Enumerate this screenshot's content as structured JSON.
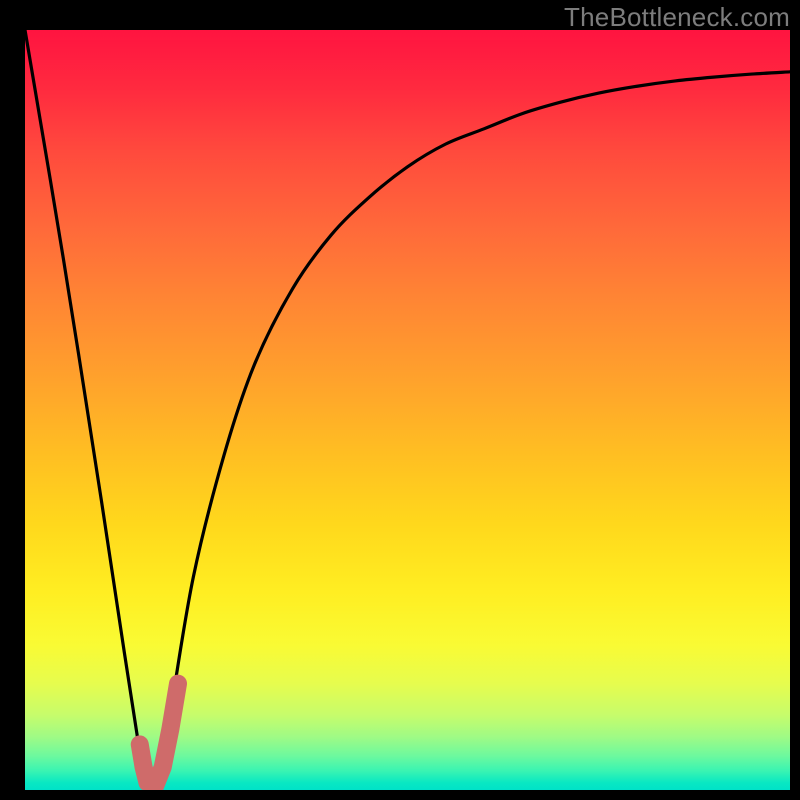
{
  "watermark": "TheBottleneck.com",
  "chart_data": {
    "type": "line",
    "title": "",
    "xlabel": "",
    "ylabel": "",
    "xlim": [
      0,
      100
    ],
    "ylim": [
      0,
      100
    ],
    "grid": false,
    "legend": false,
    "series": [
      {
        "name": "bottleneck-curve",
        "x": [
          0,
          5,
          10,
          13,
          15,
          16,
          17,
          18,
          19,
          22,
          26,
          30,
          35,
          40,
          45,
          50,
          55,
          60,
          65,
          70,
          75,
          80,
          85,
          90,
          95,
          100
        ],
        "values": [
          100,
          70,
          38,
          18,
          5,
          0,
          0,
          3,
          10,
          28,
          44,
          56,
          66,
          73,
          78,
          82,
          85,
          87,
          89,
          90.5,
          91.7,
          92.6,
          93.3,
          93.8,
          94.2,
          94.5
        ]
      }
    ],
    "marker": {
      "name": "highlight-segment",
      "points": [
        {
          "x": 15.0,
          "y": 6.0
        },
        {
          "x": 15.5,
          "y": 3.0
        },
        {
          "x": 16.0,
          "y": 1.0
        },
        {
          "x": 17.0,
          "y": 0.5
        },
        {
          "x": 18.0,
          "y": 3.0
        },
        {
          "x": 19.0,
          "y": 8.0
        },
        {
          "x": 20.0,
          "y": 14.0
        }
      ],
      "color": "#cf6b6a"
    },
    "gradient_top_color": "#ff1440",
    "gradient_bottom_color": "#00e2c8"
  }
}
